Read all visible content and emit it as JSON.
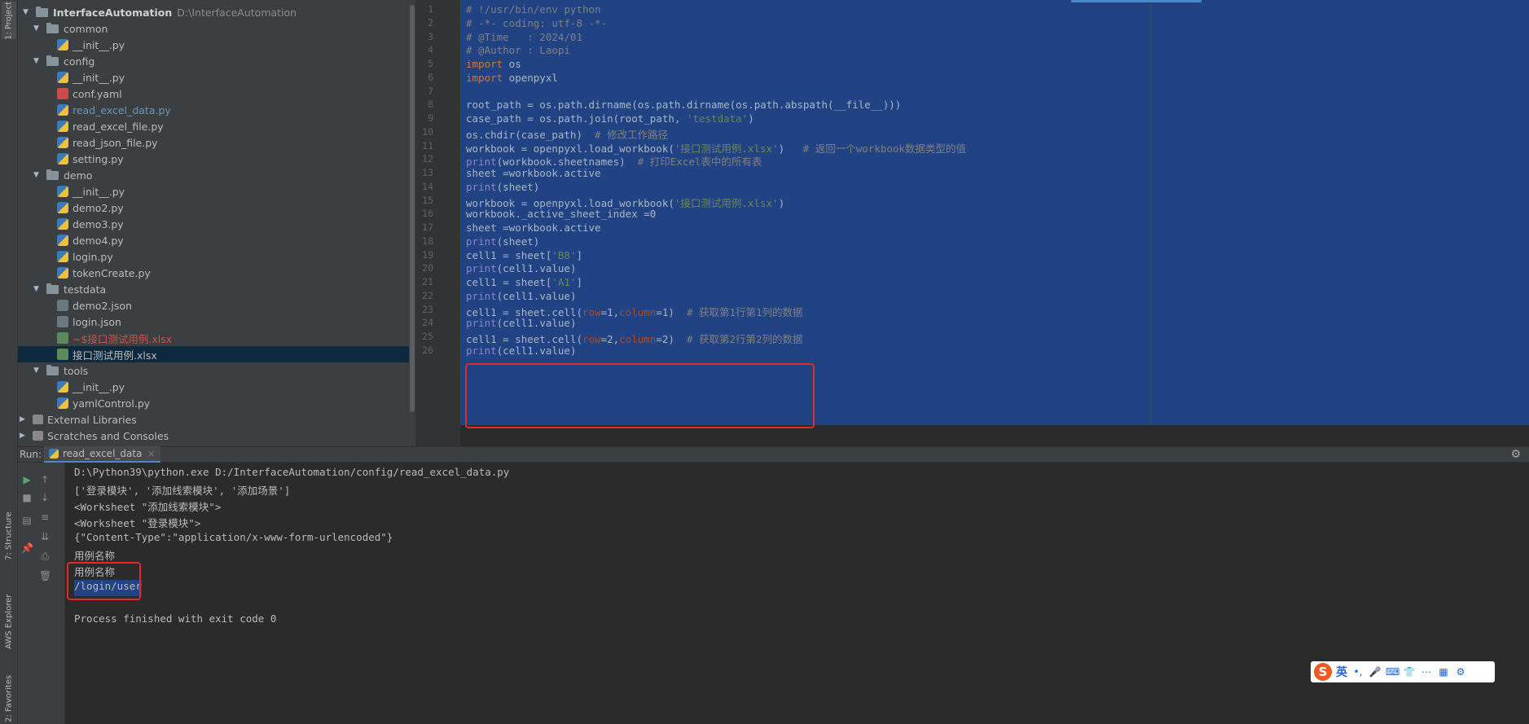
{
  "left_strip": {
    "tabs": [
      "1: Project",
      "7: Structure",
      "AWS Explorer",
      "2: Favorites"
    ]
  },
  "project": {
    "root_name": "InterfaceAutomation",
    "root_path": "D:\\InterfaceAutomation",
    "items": [
      {
        "label": "common",
        "type": "folder",
        "depth": 1
      },
      {
        "label": "__init__.py",
        "type": "py",
        "depth": 2
      },
      {
        "label": "config",
        "type": "folder",
        "depth": 1
      },
      {
        "label": "__init__.py",
        "type": "py",
        "depth": 2
      },
      {
        "label": "conf.yaml",
        "type": "yml",
        "depth": 2
      },
      {
        "label": "read_excel_data.py",
        "type": "py",
        "depth": 2,
        "style": "blue"
      },
      {
        "label": "read_excel_file.py",
        "type": "py",
        "depth": 2
      },
      {
        "label": "read_json_file.py",
        "type": "py",
        "depth": 2
      },
      {
        "label": "setting.py",
        "type": "py",
        "depth": 2
      },
      {
        "label": "demo",
        "type": "folder",
        "depth": 1
      },
      {
        "label": "__init__.py",
        "type": "py",
        "depth": 2
      },
      {
        "label": "demo2.py",
        "type": "py",
        "depth": 2
      },
      {
        "label": "demo3.py",
        "type": "py",
        "depth": 2
      },
      {
        "label": "demo4.py",
        "type": "py",
        "depth": 2
      },
      {
        "label": "login.py",
        "type": "py",
        "depth": 2
      },
      {
        "label": "tokenCreate.py",
        "type": "py",
        "depth": 2
      },
      {
        "label": "testdata",
        "type": "folder",
        "depth": 1
      },
      {
        "label": "demo2.json",
        "type": "json",
        "depth": 2
      },
      {
        "label": "login.json",
        "type": "json",
        "depth": 2
      },
      {
        "label": "~$接口测试用例.xlsx",
        "type": "xlsx",
        "depth": 2,
        "style": "red"
      },
      {
        "label": "接口测试用例.xlsx",
        "type": "xlsx",
        "depth": 2,
        "selected": true
      },
      {
        "label": "tools",
        "type": "folder",
        "depth": 1
      },
      {
        "label": "__init__.py",
        "type": "py",
        "depth": 2
      },
      {
        "label": "yamlControl.py",
        "type": "py",
        "depth": 2
      },
      {
        "label": "External Libraries",
        "type": "lib",
        "depth": 0
      },
      {
        "label": "Scratches and Consoles",
        "type": "lib",
        "depth": 0
      }
    ]
  },
  "editor": {
    "line_numbers": [
      "1",
      "2",
      "3",
      "4",
      "5",
      "6",
      "7",
      "8",
      "9",
      "10",
      "11",
      "12",
      "13",
      "14",
      "15",
      "16",
      "17",
      "18",
      "19",
      "20",
      "21",
      "22",
      "23",
      "24",
      "25",
      "26"
    ],
    "lines": [
      "# !/usr/bin/env python",
      "# -*- coding: utf-8 -*-",
      "# @Time   : 2024/01",
      "# @Author : Laopi",
      "import os",
      "import openpyxl",
      "",
      "root_path = os.path.dirname(os.path.dirname(os.path.abspath(__file__)))",
      "case_path = os.path.join(root_path, 'testdata')",
      "os.chdir(case_path)  # 修改工作路径",
      "workbook = openpyxl.load_workbook('接口测试用例.xlsx')   # 返回一个workbook数据类型的值",
      "print(workbook.sheetnames)  # 打印Excel表中的所有表",
      "sheet =workbook.active",
      "print(sheet)",
      "workbook = openpyxl.load_workbook('接口测试用例.xlsx')",
      "workbook._active_sheet_index =0",
      "sheet =workbook.active",
      "print(sheet)",
      "cell1 = sheet['B8']",
      "print(cell1.value)",
      "cell1 = sheet['A1']",
      "print(cell1.value)",
      "cell1 = sheet.cell(row=1,column=1)  # 获取第1行第1列的数据",
      "print(cell1.value)",
      "cell1 = sheet.cell(row=2,column=2)  # 获取第2行第2列的数据",
      "print(cell1.value)"
    ]
  },
  "run": {
    "label": "Run:",
    "tab_label": "read_excel_data",
    "tab_close": "×",
    "output": [
      "D:\\Python39\\python.exe D:/InterfaceAutomation/config/read_excel_data.py",
      "['登录模块', '添加线索模块', '添加场景']",
      "<Worksheet \"添加线索模块\">",
      "<Worksheet \"登录模块\">",
      "{\"Content-Type\":\"application/x-www-form-urlencoded\"}",
      "用例名称",
      "用例名称",
      "/login/user",
      "",
      "Process finished with exit code 0"
    ]
  },
  "ime": {
    "logo": "S",
    "lang": "英",
    "icons": [
      "•,",
      "🎤",
      "⌨",
      "👕",
      "⋯",
      "▦",
      "⚙"
    ]
  },
  "colors": {
    "selection": "#214283",
    "highlight_box": "#e02b2b",
    "panel_bg": "#3c3f41",
    "editor_bg": "#2b2b2b"
  }
}
